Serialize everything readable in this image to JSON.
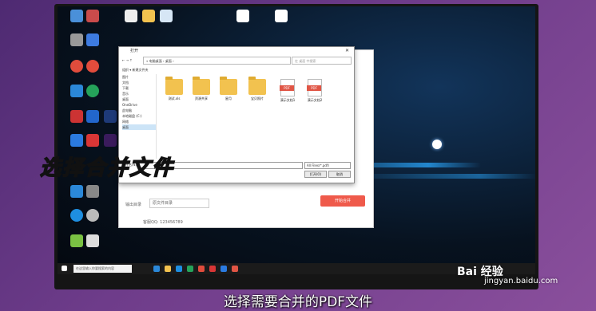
{
  "dialog": {
    "title": "打开",
    "close_glyph": "✕",
    "address": "« 电脑桌面 › 桌面 ›",
    "search_placeholder": "在 桌面 中搜索",
    "toolbar": "组织 ▾   新建文件夹",
    "nav": [
      "图片",
      "文档",
      "下载",
      "音乐",
      "桌面",
      "OneDrive",
      "此电脑",
      "本地磁盘 (C:)",
      "网络",
      "桌面"
    ],
    "files": [
      {
        "label": "测试.xls",
        "kind": "folder"
      },
      {
        "label": "资源共享",
        "kind": "folder"
      },
      {
        "label": "星月",
        "kind": "folder"
      },
      {
        "label": "宝贝照片",
        "kind": "folder"
      },
      {
        "label": "演示文档1",
        "kind": "pdf"
      },
      {
        "label": "演示文档2",
        "kind": "pdf"
      }
    ],
    "filename_label": "文件名(N):",
    "filetype": "All Files(*.pdf)",
    "open_btn": "打开(O)",
    "cancel_btn": "取消"
  },
  "bg_window": {
    "output_label": "输出目录",
    "output_value": "原文件目录",
    "merge_btn": "开始合并",
    "footer": "客服QQ: 123456789"
  },
  "taskbar": {
    "search_placeholder": "在这里输入你要搜索的内容"
  },
  "overlay_title": "选择合并文件",
  "subtitle": "选择需要合并的PDF文件",
  "watermark": {
    "brand": "Bai  经验",
    "url": "jingyan.baidu.com"
  }
}
